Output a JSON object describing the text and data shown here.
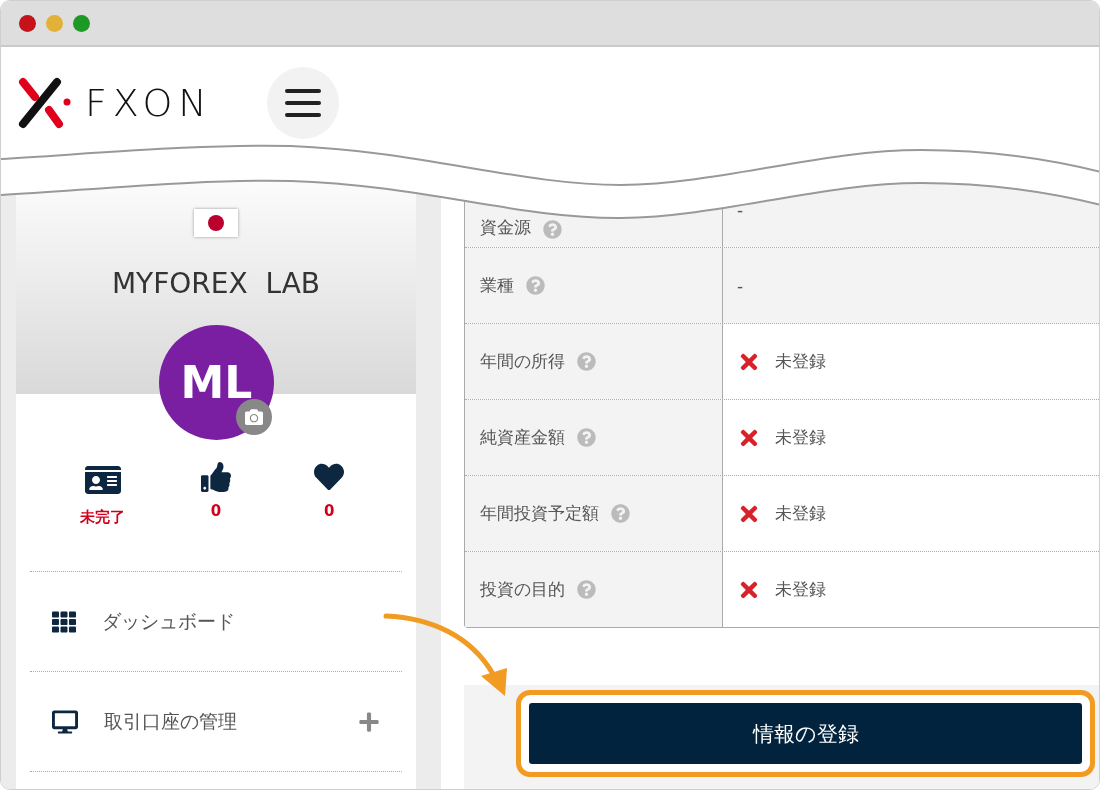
{
  "header": {
    "logo_text": "FXON"
  },
  "profile": {
    "name": "MYFOREX  LAB",
    "initials": "ML",
    "stats": [
      {
        "kind": "verification",
        "value": "未完了"
      },
      {
        "kind": "likes",
        "value": "0"
      },
      {
        "kind": "favorites",
        "value": "0"
      }
    ]
  },
  "menu": [
    {
      "kind": "dashboard",
      "label": "ダッシュボード",
      "expandable": false
    },
    {
      "kind": "accounts",
      "label": "取引口座の管理",
      "expandable": true
    }
  ],
  "fields": [
    {
      "label": "資金源",
      "kind": "plain",
      "value": "-"
    },
    {
      "label": "業種",
      "kind": "plain",
      "value": "-"
    },
    {
      "label": "年間の所得",
      "kind": "missing",
      "value": "未登録"
    },
    {
      "label": "純資産金額",
      "kind": "missing",
      "value": "未登録"
    },
    {
      "label": "年間投資予定額",
      "kind": "missing",
      "value": "未登録"
    },
    {
      "label": "投資の目的",
      "kind": "missing",
      "value": "未登録"
    }
  ],
  "submit_button": "情報の登録"
}
